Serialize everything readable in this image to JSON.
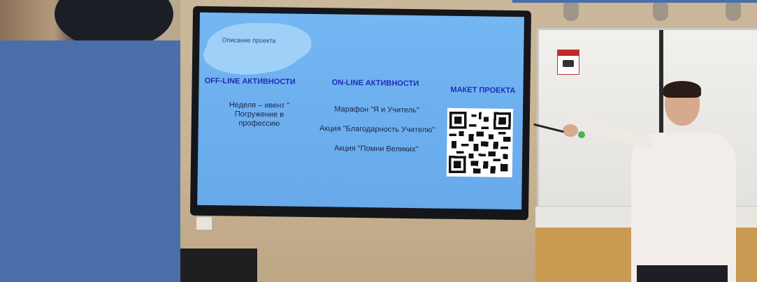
{
  "slide": {
    "cloud_label": "Описание проекта",
    "columns": [
      {
        "heading": "OFF-LINE АКТИВНОСТИ",
        "items": [
          "Неделя – ивент \"",
          "Погружение в",
          "профессию"
        ]
      },
      {
        "heading": "ON-LINE АКТИВНОСТИ",
        "items": [
          "Марафон \"Я и Учитель\"",
          "Акция \"Благодарность Учителю\"",
          "Акция \"Помни Великих\""
        ]
      },
      {
        "heading": "МАКЕТ ПРОЕКТА",
        "items": []
      }
    ]
  },
  "colors": {
    "slide_bg": "#6fb0ee",
    "heading": "#1f2db5",
    "panel": "#4a6fa8"
  }
}
